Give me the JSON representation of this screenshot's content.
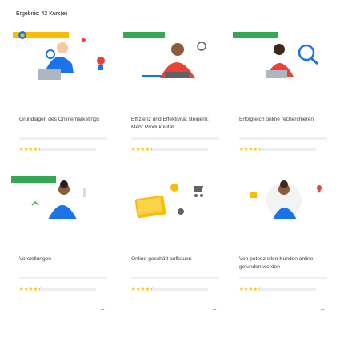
{
  "header": {
    "results_label": "Ergebnis: 42 Kurs(e)"
  },
  "cards": [
    {
      "title": "Grundlagen des Onlinemarketings",
      "stars": "★★★★★",
      "arrow": "→"
    },
    {
      "title": "Effizienz und Effektivität steigern: Mehr Produktivität",
      "stars": "★★★★★",
      "arrow": "→"
    },
    {
      "title": "Erfolgreich online recherchieren",
      "stars": "★★★★★",
      "arrow": "→"
    },
    {
      "title": "Vorstellungen",
      "stars": "★★★★★",
      "arrow": "→"
    },
    {
      "title": "Online-geschäft aufbauen",
      "stars": "★★★★★",
      "arrow": "→"
    },
    {
      "title": "Von potenziellen Kunden online gefunden werden",
      "stars": "★★★★★",
      "arrow": "→"
    }
  ],
  "colors": {
    "accent_blue": "#1a73e8",
    "green": "#34a853",
    "yellow": "#fbbc04",
    "red": "#ea4335"
  }
}
